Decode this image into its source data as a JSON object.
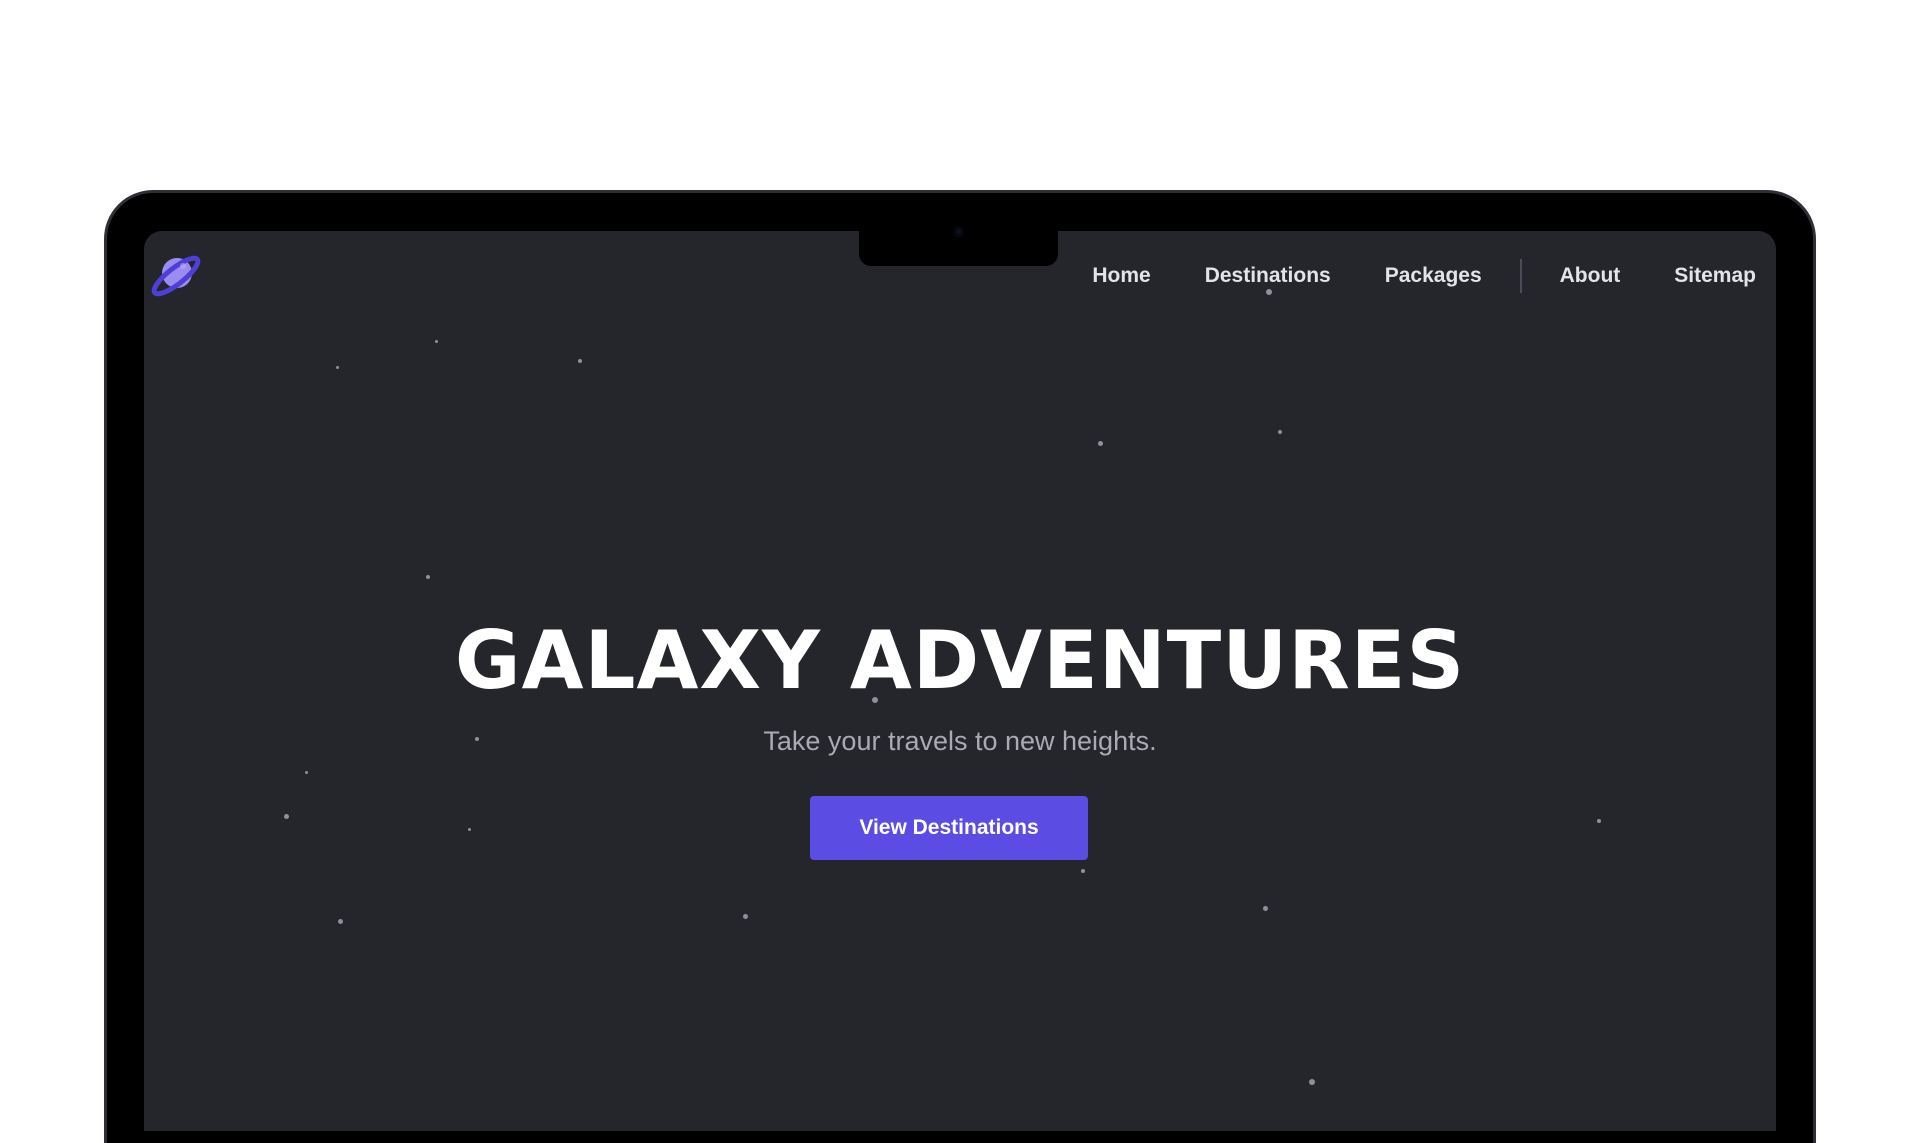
{
  "nav": {
    "items": [
      {
        "label": "Home"
      },
      {
        "label": "Destinations"
      },
      {
        "label": "Packages"
      },
      {
        "label": "About"
      },
      {
        "label": "Sitemap"
      }
    ]
  },
  "hero": {
    "title": "GALAXY ADVENTURES",
    "subtitle": "Take your travels to new heights.",
    "cta_label": "View Destinations"
  },
  "logo": {
    "icon": "planet-icon"
  },
  "colors": {
    "background": "#25262b",
    "accent": "#5b4ce3",
    "logo_planet": "#9b8cf2",
    "logo_ring": "#4f3fd6",
    "text_primary": "#ffffff",
    "text_muted": "#aaabb2"
  }
}
